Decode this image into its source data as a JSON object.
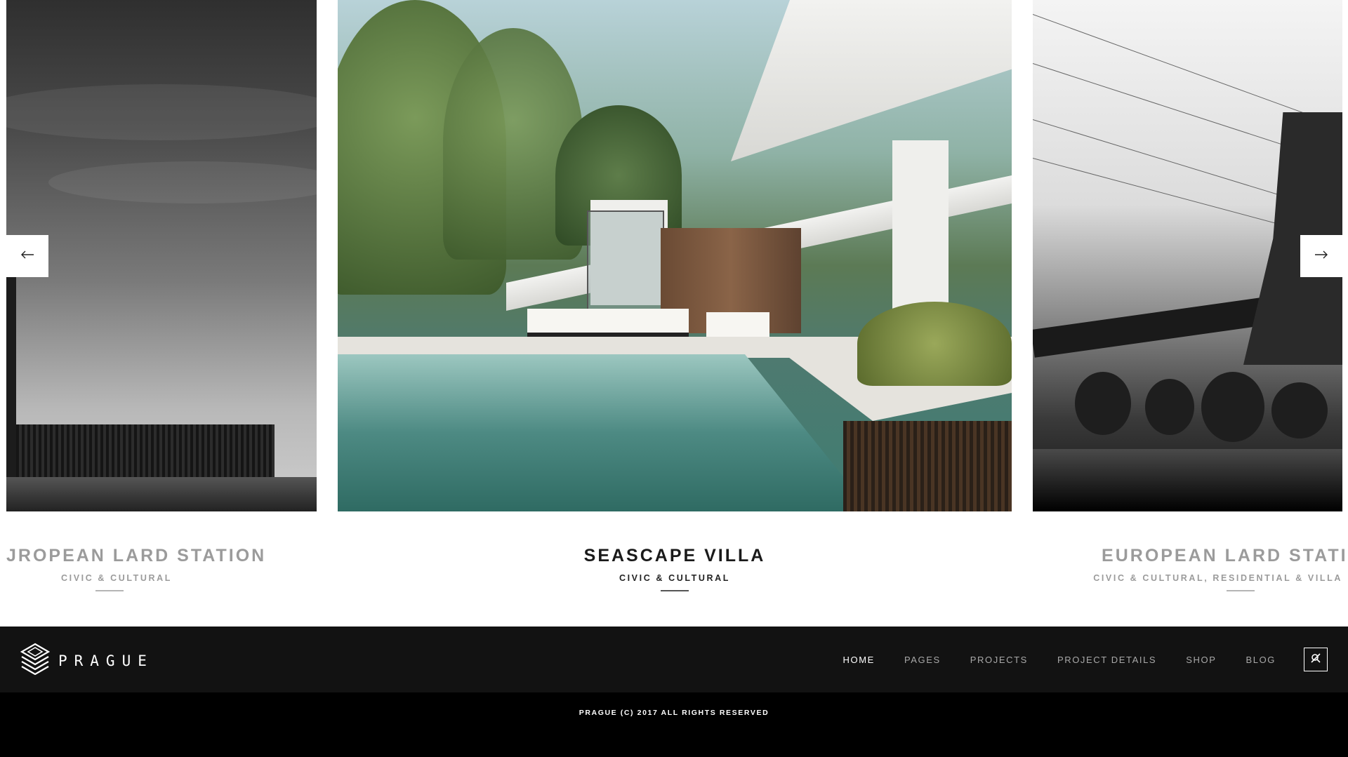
{
  "slides": [
    {
      "title": "JROPEAN LARD STATION",
      "category": "CIVIC & CULTURAL"
    },
    {
      "title": "SEASCAPE VILLA",
      "category": "CIVIC & CULTURAL"
    },
    {
      "title": "EUROPEAN LARD STATIO",
      "category": "CIVIC & CULTURAL, RESIDENTIAL & VILLA"
    }
  ],
  "arrows": {
    "prev_icon": "arrow-left-icon",
    "next_icon": "arrow-right-icon"
  },
  "brand": {
    "name": "PRAGUE",
    "logo_icon": "prague-logo-icon"
  },
  "menu": {
    "items": [
      {
        "label": "HOME",
        "active": true
      },
      {
        "label": "PAGES",
        "active": false
      },
      {
        "label": "PROJECTS",
        "active": false
      },
      {
        "label": "PROJECT DETAILS",
        "active": false
      },
      {
        "label": "SHOP",
        "active": false
      },
      {
        "label": "BLOG",
        "active": false
      }
    ],
    "search_icon": "search-icon"
  },
  "footer": {
    "copyright": "PRAGUE (C) 2017 ALL RIGHTS RESERVED"
  },
  "colors": {
    "footer_bar": "#121212",
    "copyright_bar": "#000000",
    "active_menu": "#ffffff",
    "menu_text": "#a9a9a9"
  }
}
